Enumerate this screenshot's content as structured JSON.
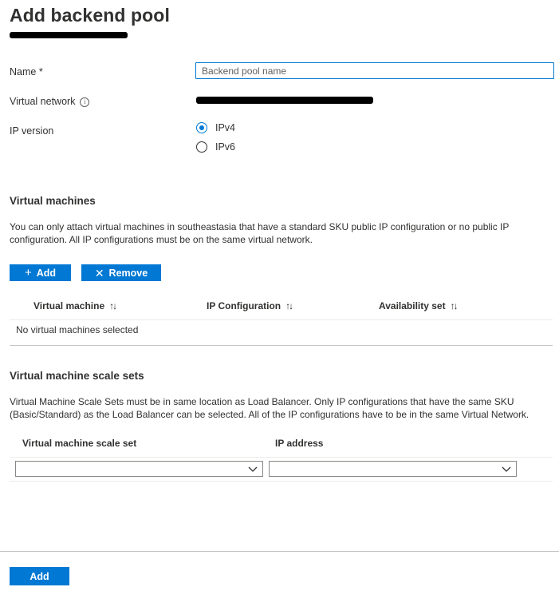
{
  "page": {
    "title": "Add backend pool"
  },
  "form": {
    "name_label": "Name *",
    "name_placeholder": "Backend pool name",
    "vnet_label": "Virtual network",
    "ip_version_label": "IP version",
    "ip_options": [
      {
        "label": "IPv4",
        "selected": true
      },
      {
        "label": "IPv6",
        "selected": false
      }
    ]
  },
  "vm_section": {
    "title": "Virtual machines",
    "description": "You can only attach virtual machines in southeastasia that have a standard SKU public IP configuration or no public IP configuration. All IP configurations must be on the same virtual network.",
    "add_label": "Add",
    "remove_label": "Remove",
    "columns": [
      "Virtual machine",
      "IP Configuration",
      "Availability set"
    ],
    "empty_text": "No virtual machines selected"
  },
  "vmss_section": {
    "title": "Virtual machine scale sets",
    "description": "Virtual Machine Scale Sets must be in same location as Load Balancer. Only IP configurations that have the same SKU (Basic/Standard) as the Load Balancer can be selected. All of the IP configurations have to be in the same Virtual Network.",
    "columns": [
      "Virtual machine scale set",
      "IP address"
    ]
  },
  "footer": {
    "add_label": "Add"
  },
  "colors": {
    "accent": "#0078d4",
    "text": "#323130",
    "divider": "#edebe9"
  },
  "icons": [
    "info-icon",
    "plus-icon",
    "close-icon",
    "sort-icon",
    "chevron-down-icon"
  ]
}
